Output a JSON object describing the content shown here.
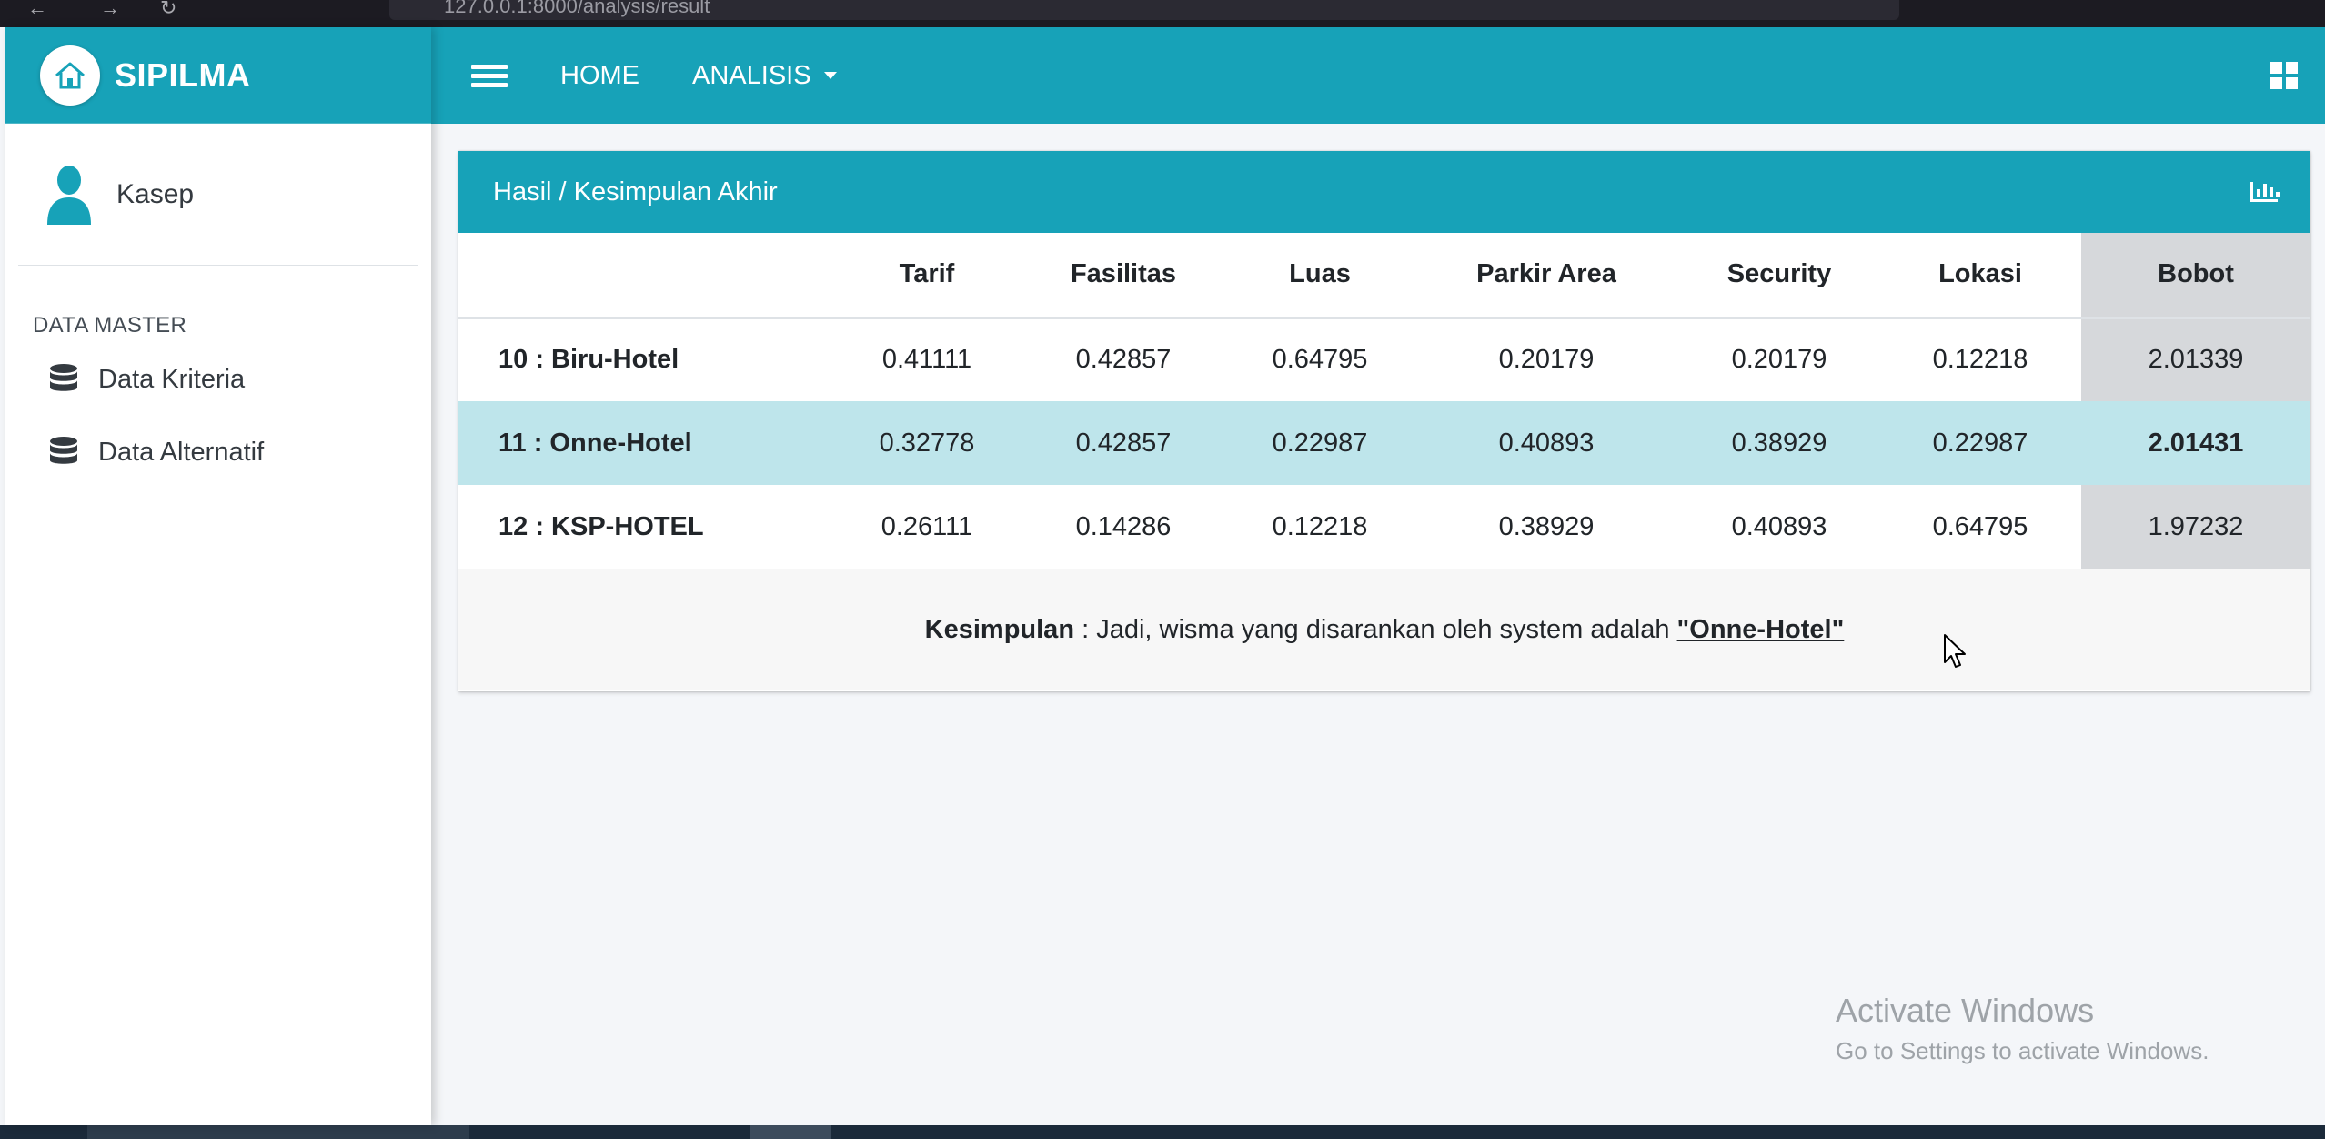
{
  "browser": {
    "url": "127.0.0.1:8000/analysis/result"
  },
  "brand": {
    "name": "SIPILMA",
    "logo_icon": "home-icon"
  },
  "user": {
    "name": "Kasep",
    "avatar_icon": "user-icon"
  },
  "sidebar": {
    "section_header": "DATA MASTER",
    "items": [
      {
        "label": "Data Kriteria",
        "icon": "database-icon"
      },
      {
        "label": "Data Alternatif",
        "icon": "database-icon"
      }
    ]
  },
  "topnav": {
    "menu_icon": "hamburger-icon",
    "links": [
      {
        "label": "HOME"
      },
      {
        "label": "ANALISIS",
        "dropdown": true
      }
    ],
    "right_icon": "grid-icon"
  },
  "card": {
    "title": "Hasil / Kesimpulan Akhir",
    "header_icon": "bar-chart-icon"
  },
  "table": {
    "columns": [
      "",
      "Tarif",
      "Fasilitas",
      "Luas",
      "Parkir Area",
      "Security",
      "Lokasi",
      "Bobot"
    ],
    "rows": [
      {
        "name": "10 : Biru-Hotel",
        "values": [
          "0.41111",
          "0.42857",
          "0.64795",
          "0.20179",
          "0.20179",
          "0.12218"
        ],
        "bobot": "2.01339",
        "highlight": false
      },
      {
        "name": "11 : Onne-Hotel",
        "values": [
          "0.32778",
          "0.42857",
          "0.22987",
          "0.40893",
          "0.38929",
          "0.22987"
        ],
        "bobot": "2.01431",
        "highlight": true
      },
      {
        "name": "12 : KSP-HOTEL",
        "values": [
          "0.26111",
          "0.14286",
          "0.12218",
          "0.38929",
          "0.40893",
          "0.64795"
        ],
        "bobot": "1.97232",
        "highlight": false
      }
    ]
  },
  "conclusion": {
    "label": "Kesimpulan",
    "text": " : Jadi, wisma yang disarankan oleh system adalah ",
    "result": "\"Onne-Hotel\""
  },
  "watermark": {
    "line1": "Activate Windows",
    "line2": "Go to Settings to activate Windows."
  },
  "colors": {
    "primary": "#17a2b8",
    "highlight_row": "#bee5eb",
    "bobot_column": "#d6d8db"
  }
}
